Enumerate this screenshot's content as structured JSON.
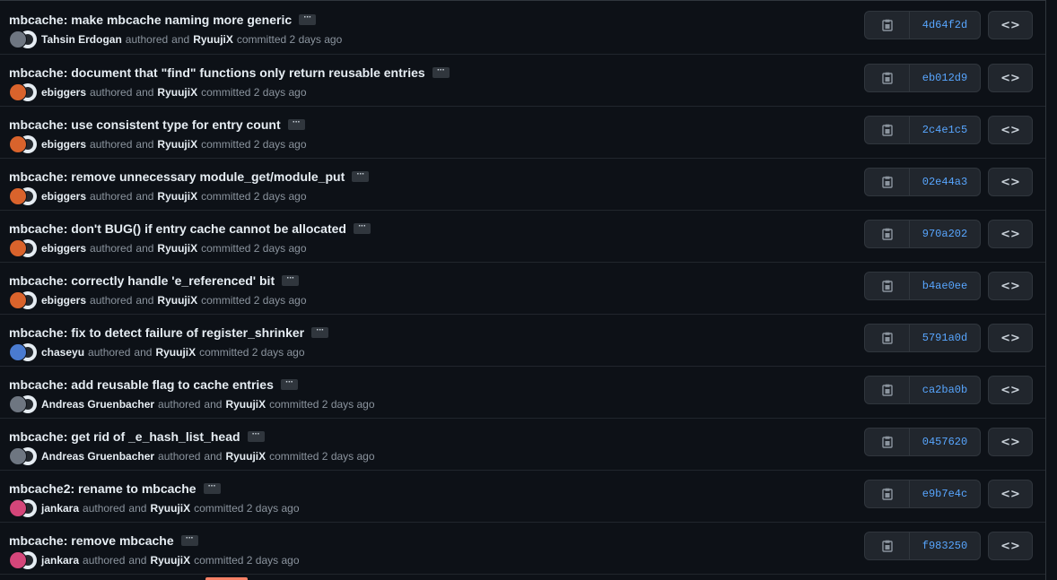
{
  "commits": [
    {
      "title": "mbcache: make mbcache naming more generic",
      "author": "Tahsin Erdogan",
      "authored_word": "authored",
      "and_word": "and",
      "committer": "RyuujiX",
      "committed_text": "committed 2 days ago",
      "sha": "4d64f2d",
      "avatar_color": "#6e7681"
    },
    {
      "title": "mbcache: document that \"find\" functions only return reusable entries",
      "author": "ebiggers",
      "authored_word": "authored",
      "and_word": "and",
      "committer": "RyuujiX",
      "committed_text": "committed 2 days ago",
      "sha": "eb012d9",
      "avatar_color": "#d9632c"
    },
    {
      "title": "mbcache: use consistent type for entry count",
      "author": "ebiggers",
      "authored_word": "authored",
      "and_word": "and",
      "committer": "RyuujiX",
      "committed_text": "committed 2 days ago",
      "sha": "2c4e1c5",
      "avatar_color": "#d9632c"
    },
    {
      "title": "mbcache: remove unnecessary module_get/module_put",
      "author": "ebiggers",
      "authored_word": "authored",
      "and_word": "and",
      "committer": "RyuujiX",
      "committed_text": "committed 2 days ago",
      "sha": "02e44a3",
      "avatar_color": "#d9632c"
    },
    {
      "title": "mbcache: don't BUG() if entry cache cannot be allocated",
      "author": "ebiggers",
      "authored_word": "authored",
      "and_word": "and",
      "committer": "RyuujiX",
      "committed_text": "committed 2 days ago",
      "sha": "970a202",
      "avatar_color": "#d9632c"
    },
    {
      "title": "mbcache: correctly handle 'e_referenced' bit",
      "author": "ebiggers",
      "authored_word": "authored",
      "and_word": "and",
      "committer": "RyuujiX",
      "committed_text": "committed 2 days ago",
      "sha": "b4ae0ee",
      "avatar_color": "#d9632c"
    },
    {
      "title": "mbcache: fix to detect failure of register_shrinker",
      "author": "chaseyu",
      "authored_word": "authored",
      "and_word": "and",
      "committer": "RyuujiX",
      "committed_text": "committed 2 days ago",
      "sha": "5791a0d",
      "avatar_color": "#4a7bd0"
    },
    {
      "title": "mbcache: add reusable flag to cache entries",
      "author": "Andreas Gruenbacher",
      "authored_word": "authored",
      "and_word": "and",
      "committer": "RyuujiX",
      "committed_text": "committed 2 days ago",
      "sha": "ca2ba0b",
      "avatar_color": "#6e7681"
    },
    {
      "title": "mbcache: get rid of _e_hash_list_head",
      "author": "Andreas Gruenbacher",
      "authored_word": "authored",
      "and_word": "and",
      "committer": "RyuujiX",
      "committed_text": "committed 2 days ago",
      "sha": "0457620",
      "avatar_color": "#6e7681"
    },
    {
      "title": "mbcache2: rename to mbcache",
      "author": "jankara",
      "authored_word": "authored",
      "and_word": "and",
      "committer": "RyuujiX",
      "committed_text": "committed 2 days ago",
      "sha": "e9b7e4c",
      "avatar_color": "#d4467a"
    },
    {
      "title": "mbcache: remove mbcache",
      "author": "jankara",
      "authored_word": "authored",
      "and_word": "and",
      "committer": "RyuujiX",
      "committed_text": "committed 2 days ago",
      "sha": "f983250",
      "avatar_color": "#d4467a"
    }
  ],
  "ui": {
    "ellipsis": "···",
    "browse_label": "<>",
    "copy_icon": "clipboard-icon"
  },
  "colors": {
    "background": "#0d1117",
    "title": "#e6edf3",
    "muted": "#8b949e",
    "link": "#58a6ff",
    "accent": "#f78166"
  }
}
